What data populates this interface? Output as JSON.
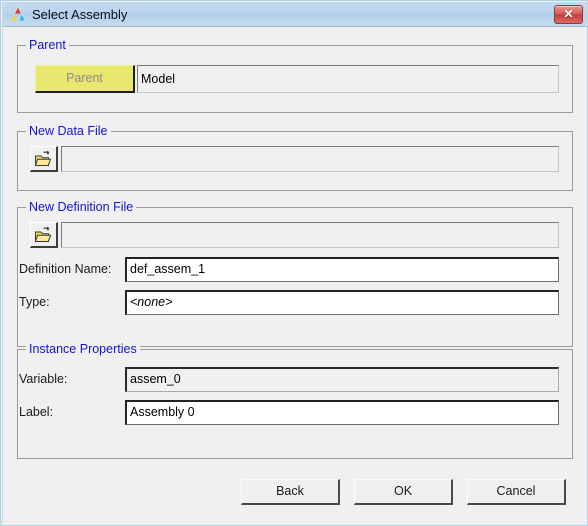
{
  "window": {
    "title": "Select Assembly",
    "icon": "triangle-logo-icon",
    "close_label": "✕",
    "accent_title_gradient": "#bcd6ee",
    "close_color": "#c13f39",
    "group_label_color": "#1414d2",
    "parent_button_color": "#e8e86e"
  },
  "groups": {
    "parent": {
      "label": "Parent",
      "button_label": "Parent",
      "value": "Model"
    },
    "new_data_file": {
      "label": "New Data File",
      "browse_icon": "open-folder-icon",
      "value": "",
      "placeholder": ""
    },
    "new_definition_file": {
      "label": "New Definition File",
      "browse_icon": "open-folder-icon",
      "path_value": "",
      "path_placeholder": "",
      "fields": [
        {
          "label": "Definition Name:",
          "value": "def_assem_1",
          "italic": false
        },
        {
          "label": "Type:",
          "value": "<none>",
          "italic": true
        }
      ]
    },
    "instance_properties": {
      "label": "Instance Properties",
      "fields": [
        {
          "label": "Variable:",
          "value": "assem_0",
          "readonly": true
        },
        {
          "label": "Label:",
          "value": "Assembly 0",
          "readonly": false
        }
      ]
    }
  },
  "footer": {
    "back_label": "Back",
    "ok_label": "OK",
    "cancel_label": "Cancel"
  }
}
